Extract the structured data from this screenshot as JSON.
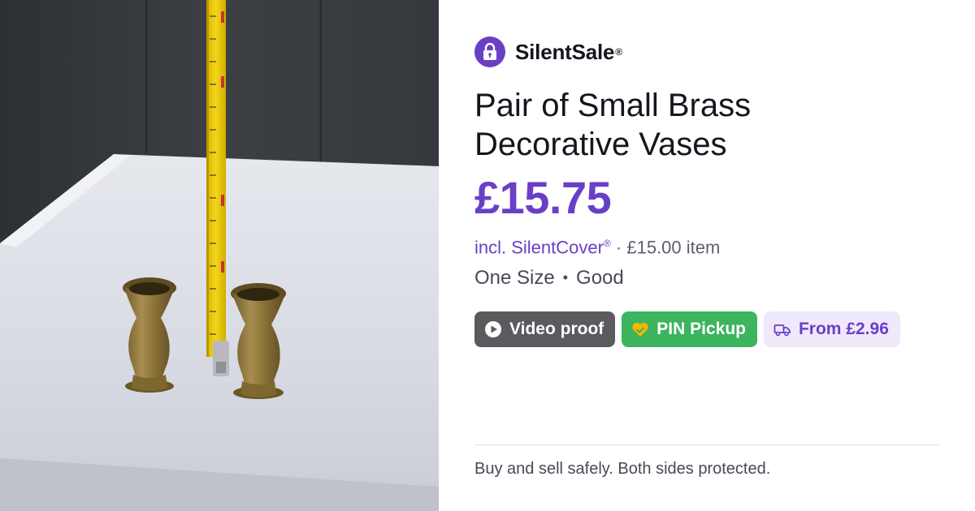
{
  "brand": {
    "name": "SilentSale",
    "reg": "®",
    "logo_icon": "padlock-icon",
    "color": "#6a3fc7"
  },
  "listing": {
    "title": "Pair of Small Brass Decorative Vases",
    "price": "£15.75",
    "cover_label": "incl. SilentCover",
    "cover_reg": "®",
    "item_price": "· £15.00 item",
    "size": "One Size",
    "separator": "•",
    "condition": "Good"
  },
  "badges": {
    "video": {
      "label": "Video proof",
      "icon": "play-circle-icon",
      "color": "#5b5b5f"
    },
    "pin": {
      "label": "PIN Pickup",
      "icon": "handshake-heart-icon",
      "color": "#3cb55e"
    },
    "shipping": {
      "label": "From £2.96",
      "icon": "truck-icon",
      "color": "#efe9fb"
    }
  },
  "footer": {
    "tagline": "Buy and sell safely. Both sides protected."
  },
  "photo": {
    "description_icon": "product-photo"
  }
}
